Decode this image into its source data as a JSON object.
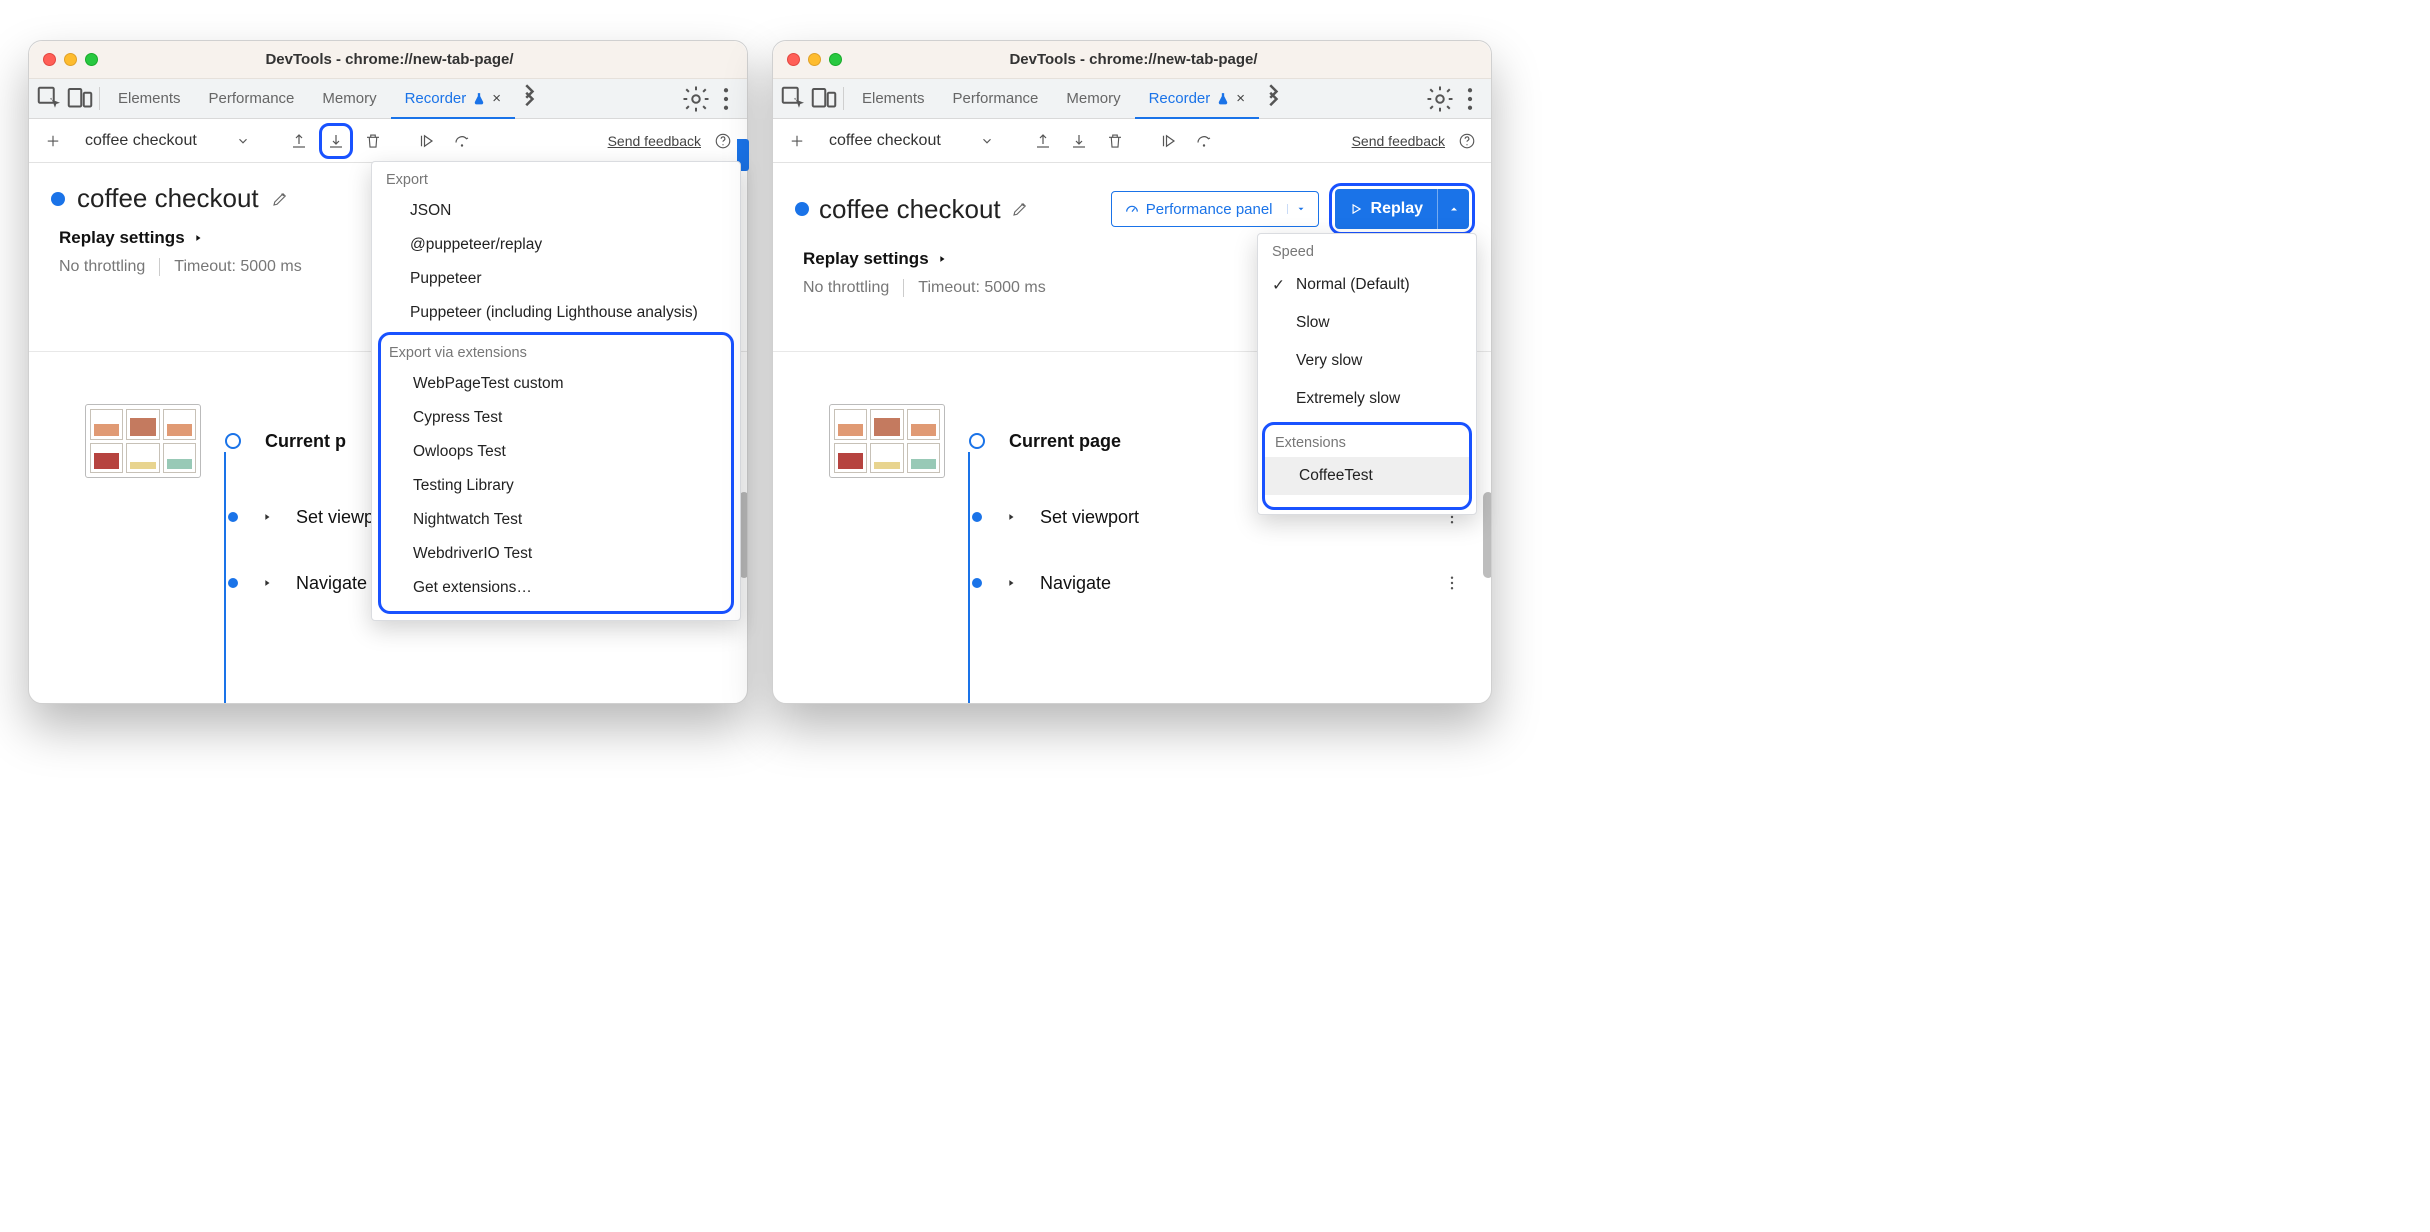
{
  "windows": {
    "left": {
      "title": "DevTools - chrome://new-tab-page/",
      "tabs": [
        "Elements",
        "Performance",
        "Memory",
        "Recorder"
      ],
      "active_tab": "Recorder",
      "recording_select": "coffee checkout",
      "send_feedback": "Send feedback",
      "recording_title": "coffee checkout",
      "replay_settings_label": "Replay settings",
      "throttling_label": "No throttling",
      "timeout_label": "Timeout: 5000 ms",
      "steps": {
        "current_page": "Current p",
        "set_viewport": "Set viewp",
        "navigate": "Navigate"
      },
      "export_dropdown": {
        "section1_title": "Export",
        "section1_items": [
          "JSON",
          "@puppeteer/replay",
          "Puppeteer",
          "Puppeteer (including Lighthouse analysis)"
        ],
        "section2_title": "Export via extensions",
        "section2_items": [
          "WebPageTest custom",
          "Cypress Test",
          "Owloops Test",
          "Testing Library",
          "Nightwatch Test",
          "WebdriverIO Test",
          "Get extensions…"
        ]
      }
    },
    "right": {
      "title": "DevTools - chrome://new-tab-page/",
      "tabs": [
        "Elements",
        "Performance",
        "Memory",
        "Recorder"
      ],
      "active_tab": "Recorder",
      "recording_select": "coffee checkout",
      "send_feedback": "Send feedback",
      "recording_title": "coffee checkout",
      "perf_panel_label": "Performance panel",
      "replay_button": "Replay",
      "replay_settings_label": "Replay settings",
      "throttling_label": "No throttling",
      "timeout_label": "Timeout: 5000 ms",
      "steps": {
        "current_page": "Current page",
        "set_viewport": "Set viewport",
        "navigate": "Navigate"
      },
      "replay_dropdown": {
        "speed_title": "Speed",
        "speed_items": [
          "Normal (Default)",
          "Slow",
          "Very slow",
          "Extremely slow"
        ],
        "ext_title": "Extensions",
        "ext_items": [
          "CoffeeTest"
        ]
      }
    }
  }
}
